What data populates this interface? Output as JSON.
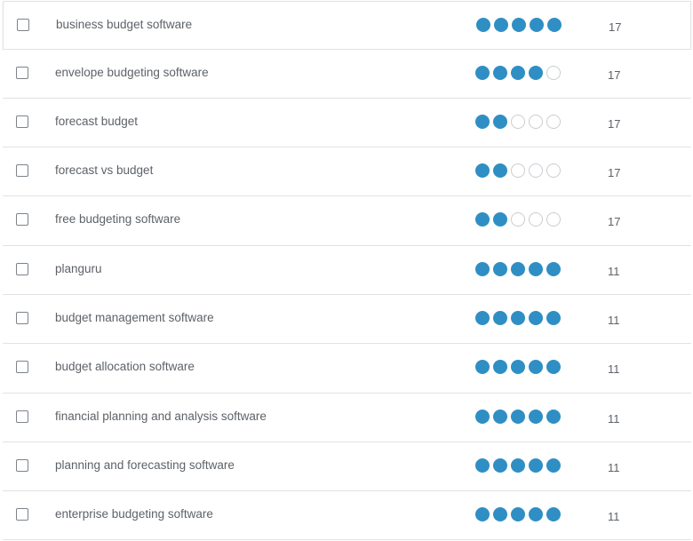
{
  "accent_color": "#2f8fc4",
  "keywords": [
    {
      "keyword": "business budget software",
      "difficulty": 5,
      "volume": "17"
    },
    {
      "keyword": "envelope budgeting software",
      "difficulty": 4,
      "volume": "17"
    },
    {
      "keyword": "forecast budget",
      "difficulty": 2,
      "volume": "17"
    },
    {
      "keyword": "forecast vs budget",
      "difficulty": 2,
      "volume": "17"
    },
    {
      "keyword": "free budgeting software",
      "difficulty": 2,
      "volume": "17"
    },
    {
      "keyword": "planguru",
      "difficulty": 5,
      "volume": "11"
    },
    {
      "keyword": "budget management software",
      "difficulty": 5,
      "volume": "11"
    },
    {
      "keyword": "budget allocation software",
      "difficulty": 5,
      "volume": "11"
    },
    {
      "keyword": "financial planning and analysis software",
      "difficulty": 5,
      "volume": "11"
    },
    {
      "keyword": "planning and forecasting software",
      "difficulty": 5,
      "volume": "11"
    },
    {
      "keyword": "enterprise budgeting software",
      "difficulty": 5,
      "volume": "11"
    }
  ],
  "max_difficulty": 5
}
